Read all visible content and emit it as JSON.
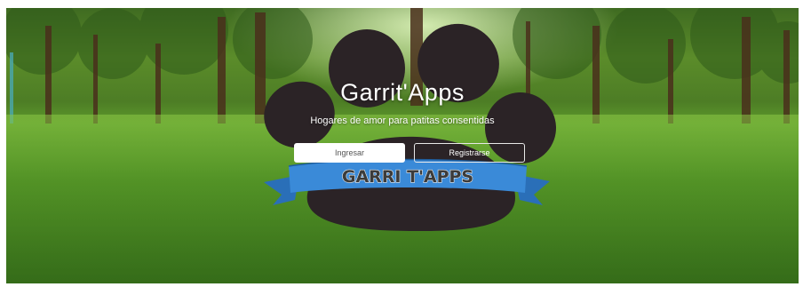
{
  "hero": {
    "title": "Garrit'Apps",
    "subtitle": "Hogares de amor para patitas consentidas"
  },
  "buttons": {
    "login_label": "Ingresar",
    "register_label": "Registrarse"
  },
  "logo": {
    "banner_text": "GARRI T'APPS"
  },
  "colors": {
    "paw": "#2b2326",
    "banner": "#2f7fcc",
    "grass": "#5b9a2c"
  }
}
